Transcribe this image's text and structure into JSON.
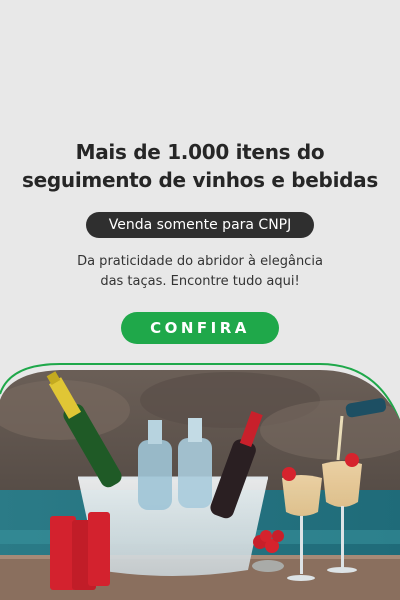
{
  "promo": {
    "headline_line1": "Mais de 1.000 itens do",
    "headline_line2": "seguimento de vinhos e bebidas",
    "badge": "Venda somente para CNPJ",
    "sub_line1": "Da praticidade do abridor à elegância",
    "sub_line2": "das taças. Encontre tudo aqui!",
    "cta": "CONFIRA"
  },
  "colors": {
    "background": "#e8e8e8",
    "accent": "#1fa84a",
    "badge_bg": "#2f2f2f"
  }
}
